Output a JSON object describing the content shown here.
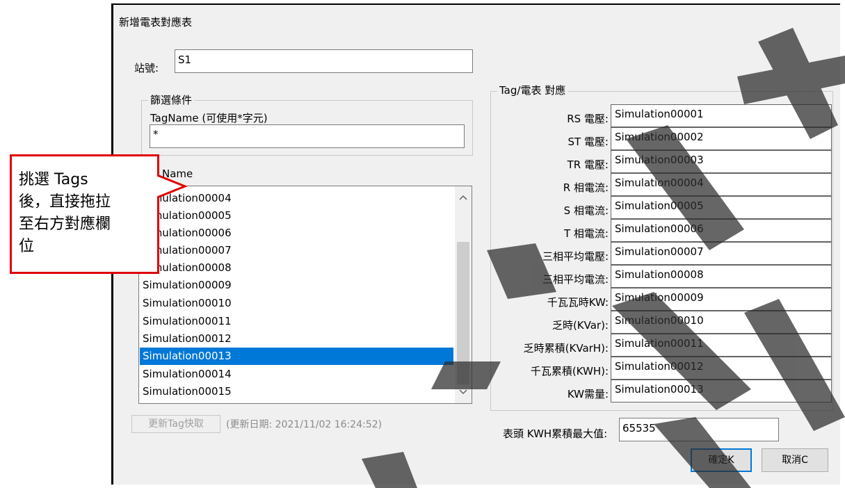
{
  "dialog": {
    "title": "新增電表對應表",
    "station_label": "站號:",
    "station_value": "S1",
    "filter": {
      "group_label": "篩選條件",
      "tagname_label": "TagName (可使用*字元)",
      "tagname_value": "*"
    },
    "list": {
      "header": "Name",
      "items": [
        "Simulation00004",
        "Simulation00005",
        "Simulation00006",
        "Simulation00007",
        "Simulation00008",
        "Simulation00009",
        "Simulation00010",
        "Simulation00011",
        "Simulation00012",
        "Simulation00013",
        "Simulation00014",
        "Simulation00015"
      ],
      "selected_item": "Simulation00013"
    },
    "refresh_button": "更新Tag快取",
    "refresh_date": "(更新日期: 2021/11/02 16:24:52)",
    "mapping": {
      "group_label": "Tag/電表 對應",
      "rows": [
        {
          "label": "RS 電壓:",
          "value": "Simulation00001"
        },
        {
          "label": "ST 電壓:",
          "value": "Simulation00002"
        },
        {
          "label": "TR 電壓:",
          "value": "Simulation00003"
        },
        {
          "label": "R 相電流:",
          "value": "Simulation00004"
        },
        {
          "label": "S 相電流:",
          "value": "Simulation00005"
        },
        {
          "label": "T 相電流:",
          "value": "Simulation00006"
        },
        {
          "label": "三相平均電壓:",
          "value": "Simulation00007"
        },
        {
          "label": "三相平均電流:",
          "value": "Simulation00008"
        },
        {
          "label": "千瓦瓦時KW:",
          "value": "Simulation00009"
        },
        {
          "label": "乏時(KVar):",
          "value": "Simulation00010"
        },
        {
          "label": "乏時累積(KVarH):",
          "value": "Simulation00011"
        },
        {
          "label": "千瓦累積(KWH):",
          "value": "Simulation00012"
        },
        {
          "label": "KW需量:",
          "value": "Simulation00013"
        }
      ]
    },
    "kwh_max_label": "表頭 KWH累積最大值:",
    "kwh_max_value": "65535",
    "ok_button": "確定K",
    "cancel_button": "取消C"
  },
  "callout": {
    "text_lines": [
      "挑選 Tags",
      "後，直接拖拉",
      "至右方對應欄",
      "位"
    ],
    "border_color": "#e00000"
  },
  "colors": {
    "selection": "#0078d7",
    "dialog_bg": "#f0f0f0"
  }
}
